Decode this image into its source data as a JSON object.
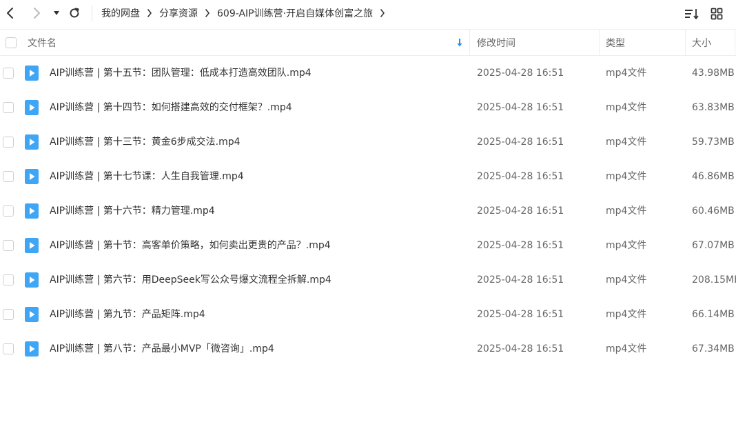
{
  "toolbar": {
    "back_icon": "chevron-left-icon",
    "forward_icon": "chevron-right-icon",
    "history_icon": "caret-down-icon",
    "refresh_icon": "refresh-icon",
    "sort_icon": "sort-list-icon",
    "grid_icon": "grid-view-icon"
  },
  "breadcrumb": {
    "items": [
      "我的网盘",
      "分享资源",
      "609-AIP训练营·开启自媒体创富之旅"
    ]
  },
  "table": {
    "headers": {
      "name": "文件名",
      "modified": "修改时间",
      "type": "类型",
      "size": "大小"
    },
    "sort_indicator_color": "#2d8cf0",
    "icon_color": "#3ea6f5",
    "rows": [
      {
        "name": "AIP训练营 | 第十五节：团队管理：低成本打造高效团队.mp4",
        "modified": "2025-04-28 16:51",
        "type": "mp4文件",
        "size": "43.98MB"
      },
      {
        "name": "AIP训练营 | 第十四节：如何搭建高效的交付框架？.mp4",
        "modified": "2025-04-28 16:51",
        "type": "mp4文件",
        "size": "63.83MB"
      },
      {
        "name": "AIP训练营 | 第十三节：黄金6步成交法.mp4",
        "modified": "2025-04-28 16:51",
        "type": "mp4文件",
        "size": "59.73MB"
      },
      {
        "name": "AIP训练营 | 第十七节课：人生自我管理.mp4",
        "modified": "2025-04-28 16:51",
        "type": "mp4文件",
        "size": "46.86MB"
      },
      {
        "name": "AIP训练营 | 第十六节：精力管理.mp4",
        "modified": "2025-04-28 16:51",
        "type": "mp4文件",
        "size": "60.46MB"
      },
      {
        "name": "AIP训练营 | 第十节：高客单价策略，如何卖出更贵的产品？.mp4",
        "modified": "2025-04-28 16:51",
        "type": "mp4文件",
        "size": "67.07MB"
      },
      {
        "name": "AIP训练营 | 第六节：用DeepSeek写公众号爆文流程全拆解.mp4",
        "modified": "2025-04-28 16:51",
        "type": "mp4文件",
        "size": "208.15MB"
      },
      {
        "name": "AIP训练营 | 第九节：产品矩阵.mp4",
        "modified": "2025-04-28 16:51",
        "type": "mp4文件",
        "size": "66.14MB"
      },
      {
        "name": "AIP训练营 | 第八节：产品最小MVP「微咨询」.mp4",
        "modified": "2025-04-28 16:51",
        "type": "mp4文件",
        "size": "67.34MB"
      }
    ]
  }
}
